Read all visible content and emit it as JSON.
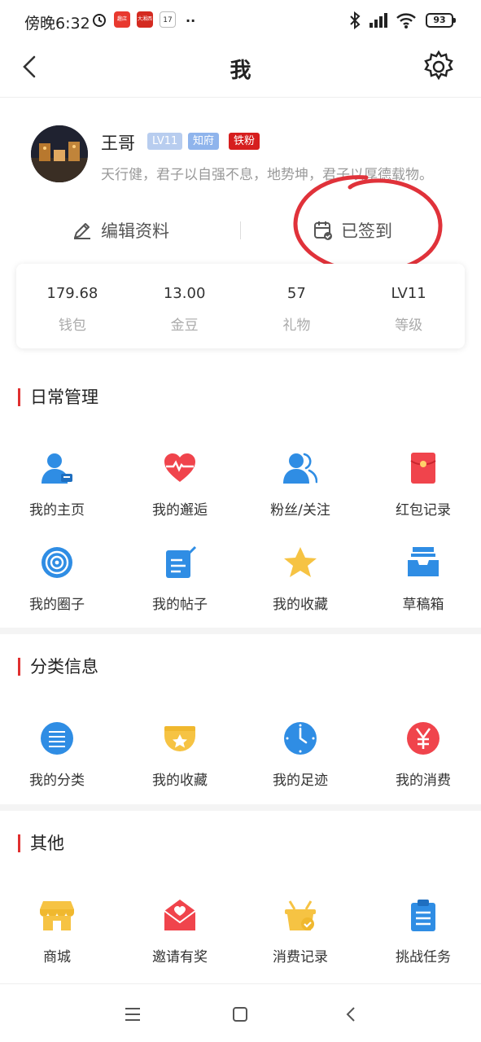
{
  "status_bar": {
    "time": "傍晚6:32",
    "battery": "93",
    "app1": "趣店",
    "app2": "大湘西",
    "app3": "17"
  },
  "header": {
    "title": "我"
  },
  "profile": {
    "name": "王哥",
    "badges": [
      "LV11",
      "知府",
      "铁粉"
    ],
    "motto": "天行健，君子以自强不息，地势坤，君子以厚德载物。",
    "edit_label": "编辑资料",
    "signin_label": "已签到"
  },
  "stats": [
    {
      "value": "179.68",
      "label": "钱包"
    },
    {
      "value": "13.00",
      "label": "金豆"
    },
    {
      "value": "57",
      "label": "礼物"
    },
    {
      "value": "LV11",
      "label": "等级"
    }
  ],
  "sections": {
    "daily": {
      "title": "日常管理",
      "items": [
        "我的主页",
        "我的邂逅",
        "粉丝/关注",
        "红包记录",
        "我的圈子",
        "我的帖子",
        "我的收藏",
        "草稿箱"
      ]
    },
    "category": {
      "title": "分类信息",
      "items": [
        "我的分类",
        "我的收藏",
        "我的足迹",
        "我的消费"
      ]
    },
    "other": {
      "title": "其他",
      "items": [
        "商城",
        "邀请有奖",
        "消费记录",
        "挑战任务"
      ]
    }
  },
  "colors": {
    "accent": "#e03030",
    "blue": "#2f8de4",
    "red": "#f0444c",
    "yellow": "#f6c343"
  }
}
